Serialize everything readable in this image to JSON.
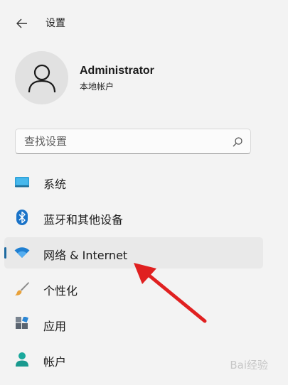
{
  "header": {
    "title": "设置"
  },
  "user": {
    "name": "Administrator",
    "account_type": "本地帐户"
  },
  "search": {
    "placeholder": "查找设置"
  },
  "nav": {
    "items": [
      {
        "label": "系统",
        "icon": "system-icon"
      },
      {
        "label": "蓝牙和其他设备",
        "icon": "bluetooth-icon"
      },
      {
        "label": "网络 & Internet",
        "icon": "wifi-icon",
        "selected": true
      },
      {
        "label": "个性化",
        "icon": "brush-icon"
      },
      {
        "label": "应用",
        "icon": "apps-icon"
      },
      {
        "label": "帐户",
        "icon": "account-icon"
      }
    ]
  },
  "watermark": "Bai经验",
  "colors": {
    "accent": "#1e6aa0",
    "arrow": "#e02020"
  }
}
